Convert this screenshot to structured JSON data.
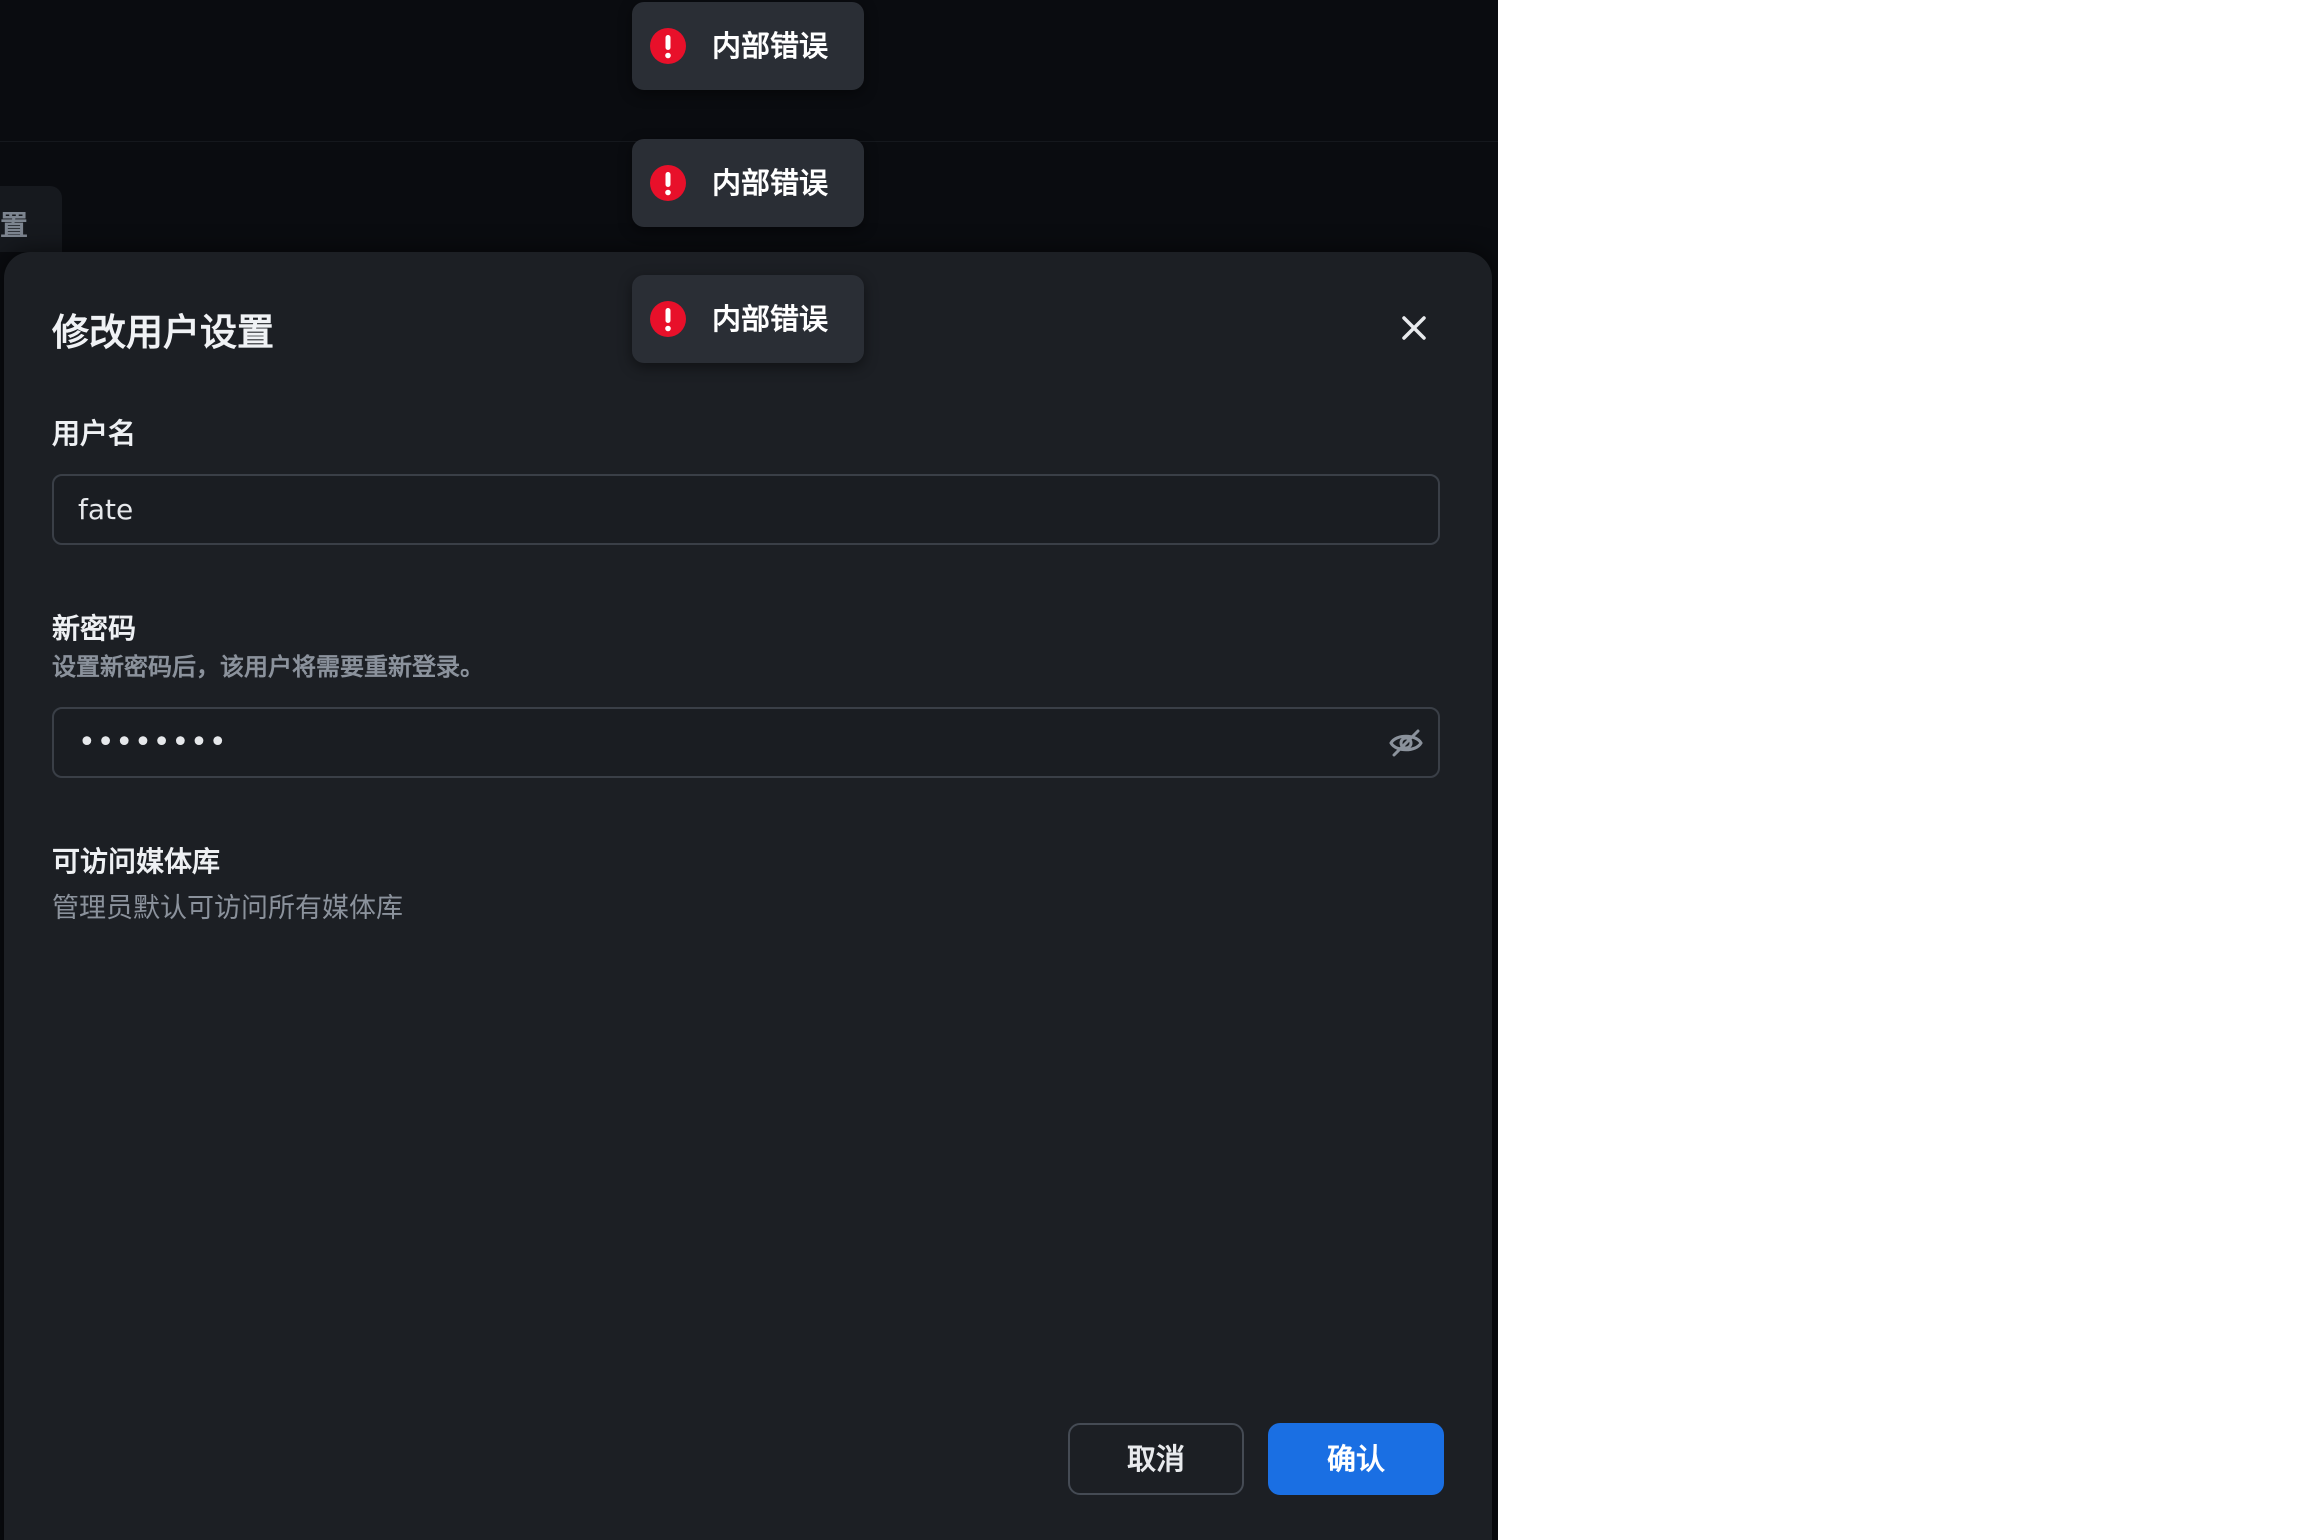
{
  "background": {
    "tab_label": "置"
  },
  "toasts": [
    {
      "icon": "error-icon",
      "message": "内部错误"
    },
    {
      "icon": "error-icon",
      "message": "内部错误"
    },
    {
      "icon": "error-icon",
      "message": "内部错误"
    }
  ],
  "modal": {
    "title": "修改用户设置",
    "close_icon": "close-icon",
    "username": {
      "label": "用户名",
      "value": "fate"
    },
    "password": {
      "label": "新密码",
      "hint": "设置新密码后，该用户将需要重新登录。",
      "value_masked": "••••••••",
      "toggle_icon": "eye-off-icon"
    },
    "libraries": {
      "label": "可访问媒体库",
      "hint": "管理员默认可访问所有媒体库"
    },
    "cancel_label": "取消",
    "confirm_label": "确认"
  },
  "colors": {
    "accent": "#1a6fe3",
    "error": "#e8102a",
    "modal_bg": "#1c1f24",
    "toast_bg": "#2a2e35"
  }
}
